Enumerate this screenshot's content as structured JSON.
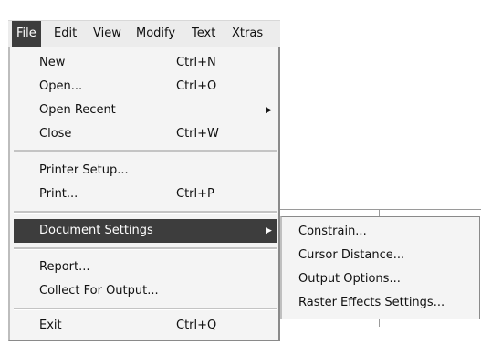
{
  "menubar": {
    "items": [
      {
        "label": "File",
        "active": true
      },
      {
        "label": "Edit"
      },
      {
        "label": "View"
      },
      {
        "label": "Modify"
      },
      {
        "label": "Text"
      },
      {
        "label": "Xtras"
      }
    ]
  },
  "file_menu": {
    "new": {
      "label": "New",
      "shortcut": "Ctrl+N"
    },
    "open": {
      "label": "Open...",
      "shortcut": "Ctrl+O"
    },
    "open_recent": {
      "label": "Open Recent",
      "submenu_icon": "right-triangle-icon"
    },
    "close": {
      "label": "Close",
      "shortcut": "Ctrl+W"
    },
    "printer_setup": {
      "label": "Printer Setup..."
    },
    "print": {
      "label": "Print...",
      "shortcut": "Ctrl+P"
    },
    "document_settings": {
      "label": "Document Settings",
      "highlighted": true,
      "submenu_icon": "right-triangle-icon"
    },
    "report": {
      "label": "Report..."
    },
    "collect_for_output": {
      "label": "Collect For Output..."
    },
    "exit": {
      "label": "Exit",
      "shortcut": "Ctrl+Q"
    }
  },
  "document_settings_submenu": {
    "items": [
      {
        "label": "Constrain..."
      },
      {
        "label": "Cursor Distance..."
      },
      {
        "label": "Output Options..."
      },
      {
        "label": "Raster Effects Settings..."
      }
    ]
  },
  "colors": {
    "highlight": "#3d3d3d",
    "menu_background": "#f4f4f4",
    "menubar_background": "#ececec"
  }
}
